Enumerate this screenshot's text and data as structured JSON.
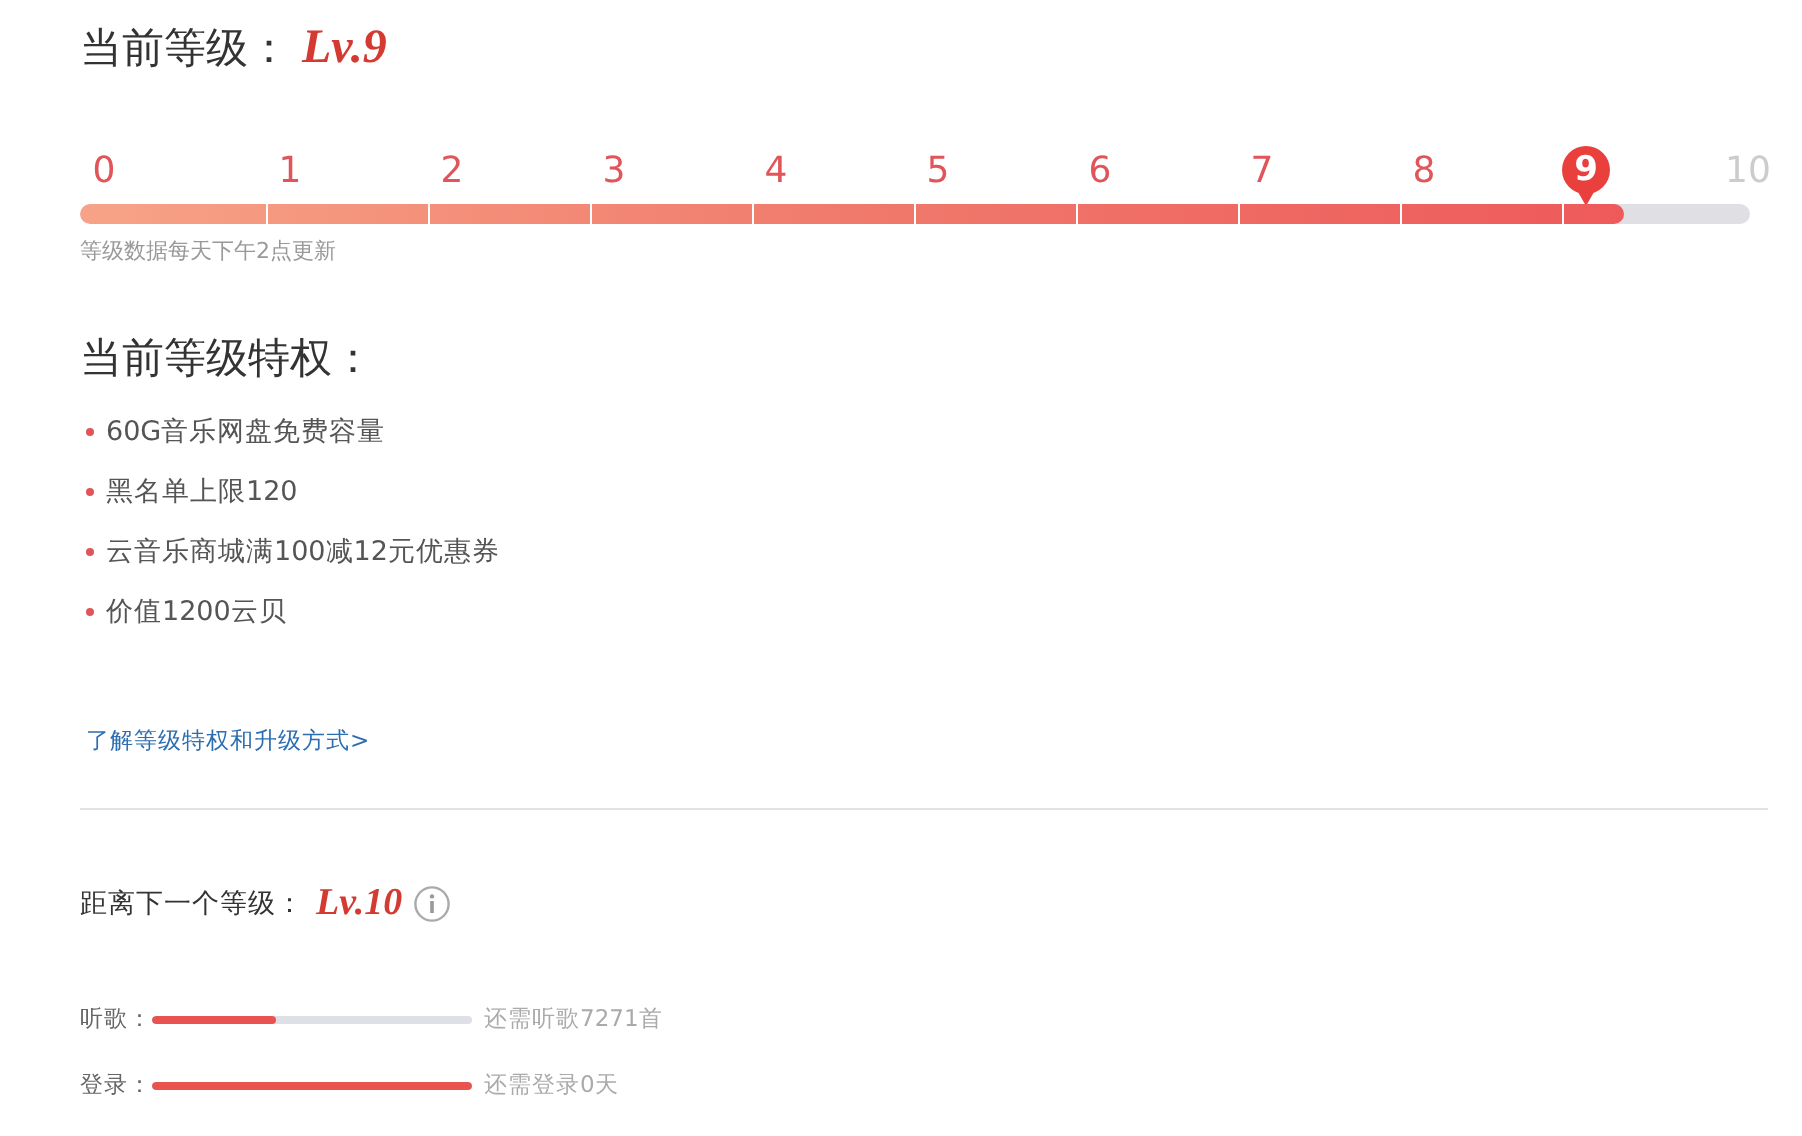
{
  "current": {
    "label": "当前等级：",
    "level": "Lv.9"
  },
  "scale": {
    "level": 0.925,
    "ticks": [
      {
        "label": "0",
        "selected": false
      },
      {
        "label": "1",
        "selected": false
      },
      {
        "label": "2",
        "selected": false
      },
      {
        "label": "3",
        "selected": false
      },
      {
        "label": "4",
        "selected": false
      },
      {
        "label": "5",
        "selected": false
      },
      {
        "label": "6",
        "selected": false
      },
      {
        "label": "7",
        "selected": false
      },
      {
        "label": "8",
        "selected": false
      },
      {
        "label": "9",
        "selected": true
      },
      {
        "label": "10",
        "selected": false
      }
    ],
    "note": "等级数据每天下午2点更新"
  },
  "privileges": {
    "title": "当前等级特权：",
    "items": [
      "60G音乐网盘免费容量",
      "黑名单上限120",
      "云音乐商城满100减12元优惠券",
      "价值1200云贝"
    ],
    "link": "了解等级特权和升级方式>"
  },
  "next": {
    "label": "距离下一个等级：",
    "level": "Lv.10",
    "requirements": [
      {
        "label": "听歌：",
        "level": 0.39,
        "reading": "还需听歌7271首"
      },
      {
        "label": "登录：",
        "level": 1,
        "reading": "还需登录0天"
      }
    ]
  }
}
